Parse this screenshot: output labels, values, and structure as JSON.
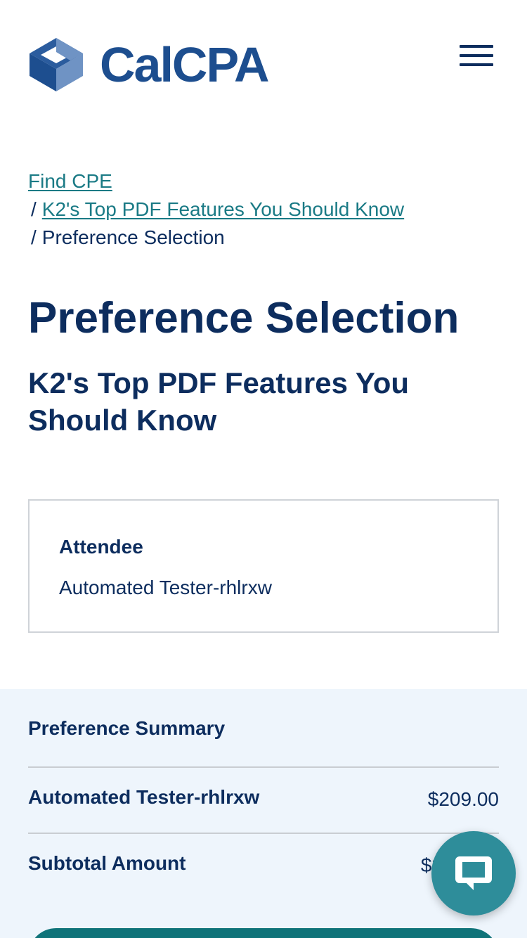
{
  "header": {
    "logo_text": "CalCPA",
    "brand_color": "#1d4e8f",
    "menu_icon": "hamburger-menu-icon"
  },
  "breadcrumb": {
    "items": [
      {
        "label": "Find CPE",
        "link": true
      },
      {
        "label": "K2's Top PDF Features You Should Know",
        "link": true
      },
      {
        "label": "Preference Selection",
        "link": false
      }
    ],
    "separator": "/"
  },
  "page": {
    "title": "Preference Selection",
    "course_title": "K2's Top PDF Features You Should Know"
  },
  "attendee": {
    "label": "Attendee",
    "name": "Automated Tester-rhlrxw"
  },
  "summary": {
    "title": "Preference Summary",
    "rows": [
      {
        "label": "Automated Tester-rhlrxw",
        "value": "$209.00"
      },
      {
        "label": "Subtotal Amount",
        "value": "$2"
      }
    ]
  },
  "chat": {
    "icon": "chat-bubble-icon"
  },
  "colors": {
    "navy": "#0d2d5e",
    "link_teal": "#1a7a85",
    "summary_bg": "#eef5fc",
    "button_teal": "#0f7379",
    "chat_teal": "#2e8d9a"
  }
}
